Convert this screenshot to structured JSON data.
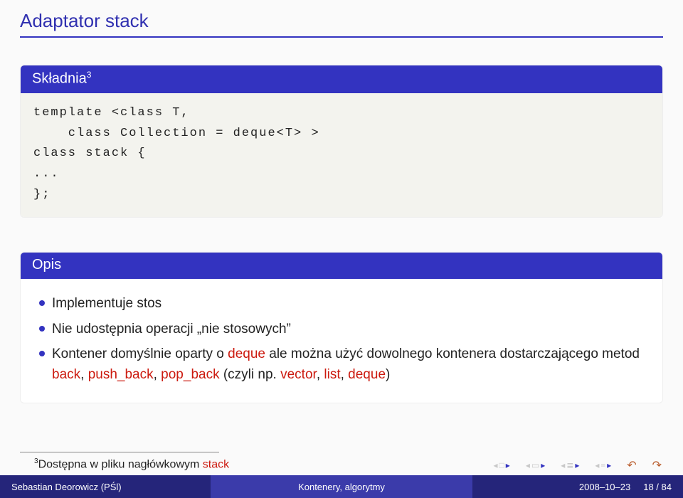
{
  "title": "Adaptator stack",
  "syntax_block": {
    "heading": "Składnia",
    "heading_sup": "3",
    "code": "template <class T,\n    class Collection = deque<T> >\nclass stack {\n...\n};"
  },
  "desc_block": {
    "heading": "Opis",
    "items": [
      {
        "parts": [
          {
            "t": "Implementuje stos"
          }
        ]
      },
      {
        "parts": [
          {
            "t": "Nie udostępnia operacji „nie stosowych”"
          }
        ]
      },
      {
        "parts": [
          {
            "t": "Kontener domyślnie oparty o "
          },
          {
            "t": "deque",
            "red": true
          },
          {
            "t": " ale można użyć dowolnego kontenera dostarczającego metod "
          },
          {
            "t": "back",
            "red": true
          },
          {
            "t": ", "
          },
          {
            "t": "push_back",
            "red": true
          },
          {
            "t": ", "
          },
          {
            "t": "pop_back",
            "red": true
          },
          {
            "t": " (czyli np. "
          },
          {
            "t": "vector",
            "red": true
          },
          {
            "t": ", "
          },
          {
            "t": "list",
            "red": true
          },
          {
            "t": ", "
          },
          {
            "t": "deque",
            "red": true
          },
          {
            "t": ")"
          }
        ]
      }
    ]
  },
  "footnote": {
    "sup": "3",
    "prefix": "Dostępna w pliku nagłówkowym ",
    "kw": "stack"
  },
  "footer": {
    "left": "Sebastian Deorowicz (PŚl)",
    "center": "Kontenery, algorytmy",
    "date": "2008–10–23",
    "page": "18 / 84"
  }
}
